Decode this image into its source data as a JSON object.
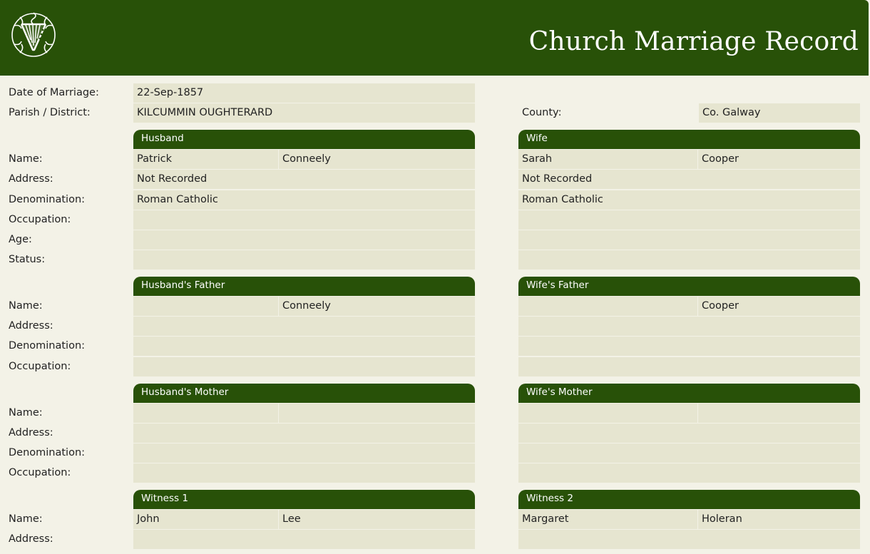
{
  "header": {
    "title": "Church Marriage Record",
    "logo_icon": "harp-emblem-icon"
  },
  "top": {
    "date_label": "Date of Marriage:",
    "date_value": "22-Sep-1857",
    "parish_label": "Parish / District:",
    "parish_value": "KILCUMMIN OUGHTERARD",
    "county_label": "County:",
    "county_value": "Co. Galway"
  },
  "labels": {
    "name": "Name:",
    "address": "Address:",
    "denomination": "Denomination:",
    "occupation": "Occupation:",
    "age": "Age:",
    "status": "Status:"
  },
  "husband": {
    "heading": "Husband",
    "first": "Patrick",
    "last": "Conneely",
    "address": "Not Recorded",
    "denomination": "Roman Catholic",
    "occupation": "",
    "age": "",
    "status": ""
  },
  "wife": {
    "heading": "Wife",
    "first": "Sarah",
    "last": "Cooper",
    "address": "Not Recorded",
    "denomination": "Roman Catholic",
    "occupation": "",
    "age": "",
    "status": ""
  },
  "husband_father": {
    "heading": "Husband's Father",
    "first": "",
    "last": "Conneely",
    "address": "",
    "denomination": "",
    "occupation": ""
  },
  "wife_father": {
    "heading": "Wife's Father",
    "first": "",
    "last": "Cooper",
    "address": "",
    "denomination": "",
    "occupation": ""
  },
  "husband_mother": {
    "heading": "Husband's Mother",
    "first": "",
    "last": "",
    "address": "",
    "denomination": "",
    "occupation": ""
  },
  "wife_mother": {
    "heading": "Wife's Mother",
    "first": "",
    "last": "",
    "address": "",
    "denomination": "",
    "occupation": ""
  },
  "witness1": {
    "heading": "Witness 1",
    "first": "John",
    "last": "Lee",
    "address": ""
  },
  "witness2": {
    "heading": "Witness 2",
    "first": "Margaret",
    "last": "Holeran",
    "address": ""
  },
  "colors": {
    "header_green": "#285108",
    "field_bg": "#e6e5d0",
    "page_bg": "#f3f2e7"
  }
}
